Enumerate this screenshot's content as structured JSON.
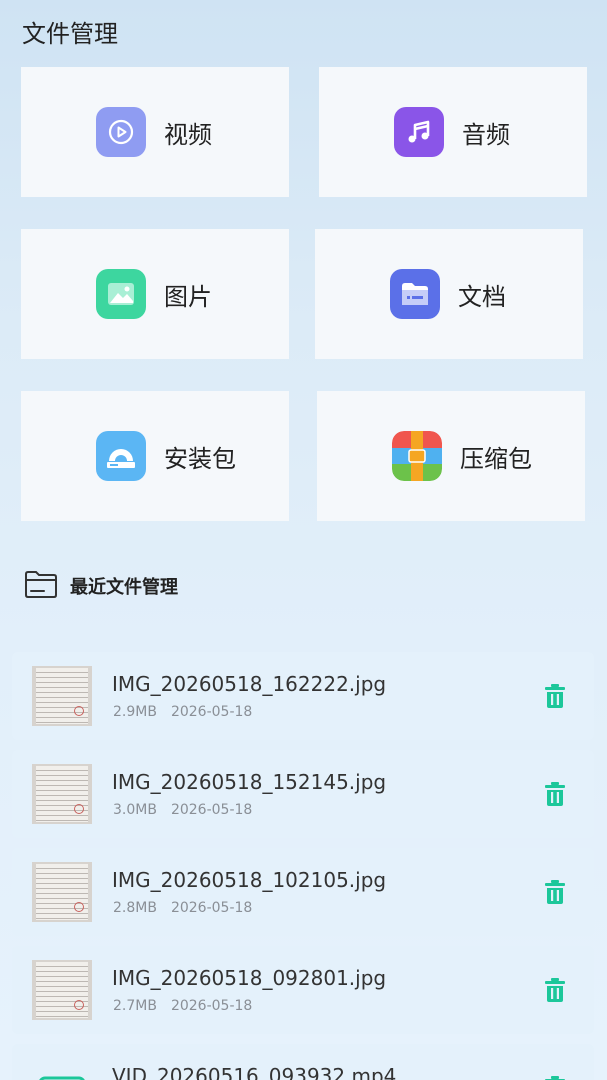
{
  "header": {
    "title": "文件管理"
  },
  "categories": [
    {
      "label": "视频",
      "icon": "video-icon",
      "color": "#8f9cf2"
    },
    {
      "label": "音频",
      "icon": "music-icon",
      "color": "#8a55e8"
    },
    {
      "label": "图片",
      "icon": "image-icon",
      "color": "#3dd69f"
    },
    {
      "label": "文档",
      "icon": "document-icon",
      "color": "#5b70e8"
    },
    {
      "label": "安装包",
      "icon": "install-package-icon",
      "color": "#5bb6f4"
    },
    {
      "label": "压缩包",
      "icon": "archive-icon",
      "color": "#f0564e"
    }
  ],
  "recent": {
    "title": "最近文件管理",
    "files": [
      {
        "name": "IMG_20260518_162222.jpg",
        "size": "2.9MB",
        "date": "2026-05-18"
      },
      {
        "name": "IMG_20260518_152145.jpg",
        "size": "3.0MB",
        "date": "2026-05-18"
      },
      {
        "name": "IMG_20260518_102105.jpg",
        "size": "2.8MB",
        "date": "2026-05-18"
      },
      {
        "name": "IMG_20260518_092801.jpg",
        "size": "2.7MB",
        "date": "2026-05-18"
      },
      {
        "name": "VID_20260516_093932.mp4",
        "size": "",
        "date": ""
      }
    ]
  },
  "colors": {
    "accent": "#1cc79a"
  }
}
